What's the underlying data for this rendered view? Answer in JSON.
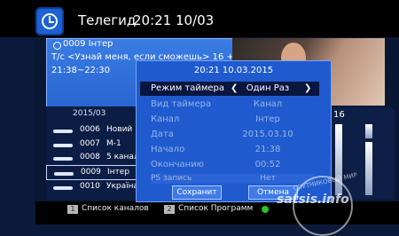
{
  "header": {
    "title": "Телегид",
    "datetime": "20:21 10/03"
  },
  "info": {
    "channel": "0009 Інтер",
    "program": "Т/с <Узнай меня, если сможешь> 16 +",
    "time": "21:38~22:30"
  },
  "list": {
    "date": "2015/03",
    "rows": [
      {
        "num": "0006",
        "name": "Новий"
      },
      {
        "num": "0007",
        "name": "M-1"
      },
      {
        "num": "0008",
        "name": "5 канал"
      },
      {
        "num": "0009",
        "name": "Інтер"
      },
      {
        "num": "0010",
        "name": "Україна"
      }
    ],
    "right_num": "16"
  },
  "dialog": {
    "datetime": "20:21 10.03.2015",
    "rows": [
      {
        "label": "Режим таймера",
        "value": "Один Раз"
      },
      {
        "label": "Вид таймера",
        "value": "Канал"
      },
      {
        "label": "Канал",
        "value": "Інтер"
      },
      {
        "label": "Дата",
        "value": "2015.03.10"
      },
      {
        "label": "Начало",
        "value": "21:38"
      },
      {
        "label": "Окончанию",
        "value": "00:52"
      },
      {
        "label": "PS запись",
        "value": "Нет"
      }
    ],
    "save_label": "Сохранит",
    "cancel_label": "Отмена"
  },
  "footer": {
    "key1": "1",
    "label1": "Список каналов",
    "key2": "2",
    "label2": "Список Программ"
  },
  "watermark": {
    "site": "satsis.info",
    "arc": "СПУТНИКОВЫЙ МИР"
  },
  "colors": {
    "dialog": "#1f5bcf",
    "selection": "#081640",
    "green_key": "#27c427"
  }
}
